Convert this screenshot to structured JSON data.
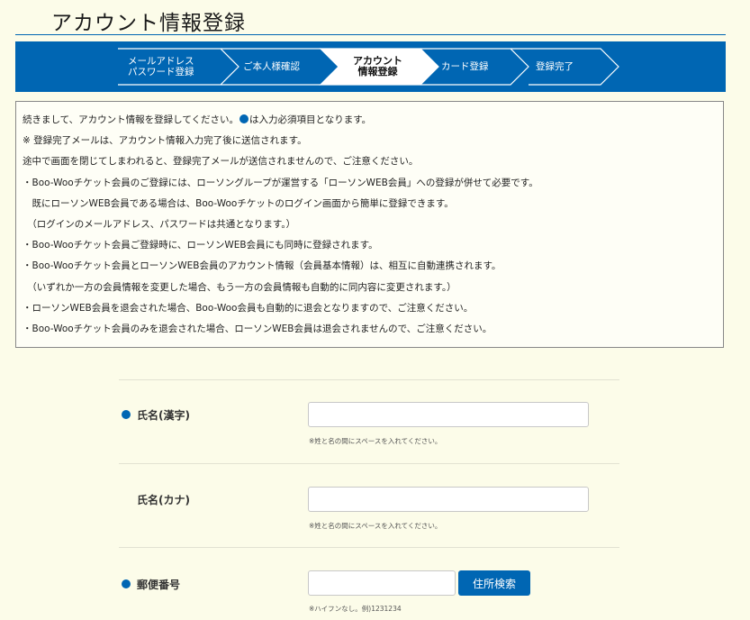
{
  "page": {
    "title": "アカウント情報登録"
  },
  "steps": [
    {
      "label": "メールアドレス\nパスワード登録",
      "active": false
    },
    {
      "label": "ご本人様確認",
      "active": false
    },
    {
      "label": "アカウント\n情報登録",
      "active": true
    },
    {
      "label": "カード登録",
      "active": false
    },
    {
      "label": "登録完了",
      "active": false
    }
  ],
  "notice": {
    "line1_before": "続きまして、アカウント情報を登録してください。",
    "line1_after": "は入力必須項目となります。",
    "lines": [
      "※ 登録完了メールは、アカウント情報入力完了後に送信されます。",
      "途中で画面を閉じてしまわれると、登録完了メールが送信されませんので、ご注意ください。",
      "・Boo-Wooチケット会員のご登録には、ローソングループが運営する「ローソンWEB会員」への登録が併せて必要です。",
      "　既にローソンWEB会員である場合は、Boo-Wooチケットのログイン画面から簡単に登録できます。",
      "　（ログインのメールアドレス、パスワードは共通となります。）",
      "・Boo-Wooチケット会員ご登録時に、ローソンWEB会員にも同時に登録されます。",
      "・Boo-Wooチケット会員とローソンWEB会員のアカウント情報（会員基本情報）は、相互に自動連携されます。",
      "　（いずれか一方の会員情報を変更した場合、もう一方の会員情報も自動的に同内容に変更されます。）",
      "・ローソンWEB会員を退会された場合、Boo-Woo会員も自動的に退会となりますので、ご注意ください。",
      "・Boo-Wooチケット会員のみを退会された場合、ローソンWEB会員は退会されませんので、ご注意ください。"
    ]
  },
  "form": {
    "name_kanji": {
      "label": "氏名(漢字)",
      "value": "",
      "hint": "※姓と名の間にスペースを入れてください。"
    },
    "name_kana": {
      "label": "氏名(カナ)",
      "value": "",
      "hint": "※姓と名の間にスペースを入れてください。"
    },
    "postal": {
      "label": "郵便番号",
      "value": "",
      "hint": "※ハイフンなし。例)1231234",
      "search_button": "住所検索"
    }
  },
  "colors": {
    "brand_blue": "#0066b3",
    "background": "#fcfce9"
  }
}
